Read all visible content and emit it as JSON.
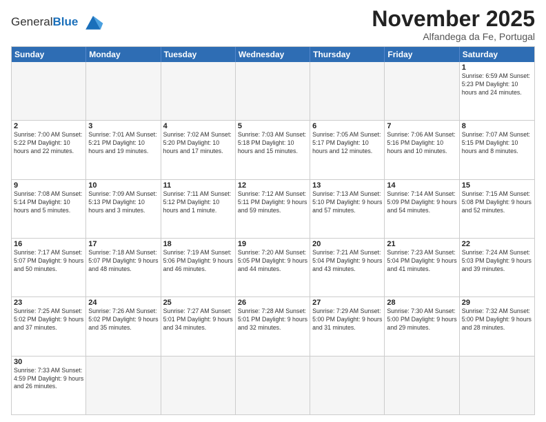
{
  "header": {
    "logo_general": "General",
    "logo_blue": "Blue",
    "month_title": "November 2025",
    "location": "Alfandega da Fe, Portugal"
  },
  "days_of_week": [
    "Sunday",
    "Monday",
    "Tuesday",
    "Wednesday",
    "Thursday",
    "Friday",
    "Saturday"
  ],
  "weeks": [
    [
      {
        "day": "",
        "empty": true
      },
      {
        "day": "",
        "empty": true
      },
      {
        "day": "",
        "empty": true
      },
      {
        "day": "",
        "empty": true
      },
      {
        "day": "",
        "empty": true
      },
      {
        "day": "",
        "empty": true
      },
      {
        "day": "1",
        "info": "Sunrise: 6:59 AM\nSunset: 5:23 PM\nDaylight: 10 hours\nand 24 minutes."
      }
    ],
    [
      {
        "day": "2",
        "info": "Sunrise: 7:00 AM\nSunset: 5:22 PM\nDaylight: 10 hours\nand 22 minutes."
      },
      {
        "day": "3",
        "info": "Sunrise: 7:01 AM\nSunset: 5:21 PM\nDaylight: 10 hours\nand 19 minutes."
      },
      {
        "day": "4",
        "info": "Sunrise: 7:02 AM\nSunset: 5:20 PM\nDaylight: 10 hours\nand 17 minutes."
      },
      {
        "day": "5",
        "info": "Sunrise: 7:03 AM\nSunset: 5:18 PM\nDaylight: 10 hours\nand 15 minutes."
      },
      {
        "day": "6",
        "info": "Sunrise: 7:05 AM\nSunset: 5:17 PM\nDaylight: 10 hours\nand 12 minutes."
      },
      {
        "day": "7",
        "info": "Sunrise: 7:06 AM\nSunset: 5:16 PM\nDaylight: 10 hours\nand 10 minutes."
      },
      {
        "day": "8",
        "info": "Sunrise: 7:07 AM\nSunset: 5:15 PM\nDaylight: 10 hours\nand 8 minutes."
      }
    ],
    [
      {
        "day": "9",
        "info": "Sunrise: 7:08 AM\nSunset: 5:14 PM\nDaylight: 10 hours\nand 5 minutes."
      },
      {
        "day": "10",
        "info": "Sunrise: 7:09 AM\nSunset: 5:13 PM\nDaylight: 10 hours\nand 3 minutes."
      },
      {
        "day": "11",
        "info": "Sunrise: 7:11 AM\nSunset: 5:12 PM\nDaylight: 10 hours\nand 1 minute."
      },
      {
        "day": "12",
        "info": "Sunrise: 7:12 AM\nSunset: 5:11 PM\nDaylight: 9 hours\nand 59 minutes."
      },
      {
        "day": "13",
        "info": "Sunrise: 7:13 AM\nSunset: 5:10 PM\nDaylight: 9 hours\nand 57 minutes."
      },
      {
        "day": "14",
        "info": "Sunrise: 7:14 AM\nSunset: 5:09 PM\nDaylight: 9 hours\nand 54 minutes."
      },
      {
        "day": "15",
        "info": "Sunrise: 7:15 AM\nSunset: 5:08 PM\nDaylight: 9 hours\nand 52 minutes."
      }
    ],
    [
      {
        "day": "16",
        "info": "Sunrise: 7:17 AM\nSunset: 5:07 PM\nDaylight: 9 hours\nand 50 minutes."
      },
      {
        "day": "17",
        "info": "Sunrise: 7:18 AM\nSunset: 5:07 PM\nDaylight: 9 hours\nand 48 minutes."
      },
      {
        "day": "18",
        "info": "Sunrise: 7:19 AM\nSunset: 5:06 PM\nDaylight: 9 hours\nand 46 minutes."
      },
      {
        "day": "19",
        "info": "Sunrise: 7:20 AM\nSunset: 5:05 PM\nDaylight: 9 hours\nand 44 minutes."
      },
      {
        "day": "20",
        "info": "Sunrise: 7:21 AM\nSunset: 5:04 PM\nDaylight: 9 hours\nand 43 minutes."
      },
      {
        "day": "21",
        "info": "Sunrise: 7:23 AM\nSunset: 5:04 PM\nDaylight: 9 hours\nand 41 minutes."
      },
      {
        "day": "22",
        "info": "Sunrise: 7:24 AM\nSunset: 5:03 PM\nDaylight: 9 hours\nand 39 minutes."
      }
    ],
    [
      {
        "day": "23",
        "info": "Sunrise: 7:25 AM\nSunset: 5:02 PM\nDaylight: 9 hours\nand 37 minutes."
      },
      {
        "day": "24",
        "info": "Sunrise: 7:26 AM\nSunset: 5:02 PM\nDaylight: 9 hours\nand 35 minutes."
      },
      {
        "day": "25",
        "info": "Sunrise: 7:27 AM\nSunset: 5:01 PM\nDaylight: 9 hours\nand 34 minutes."
      },
      {
        "day": "26",
        "info": "Sunrise: 7:28 AM\nSunset: 5:01 PM\nDaylight: 9 hours\nand 32 minutes."
      },
      {
        "day": "27",
        "info": "Sunrise: 7:29 AM\nSunset: 5:00 PM\nDaylight: 9 hours\nand 31 minutes."
      },
      {
        "day": "28",
        "info": "Sunrise: 7:30 AM\nSunset: 5:00 PM\nDaylight: 9 hours\nand 29 minutes."
      },
      {
        "day": "29",
        "info": "Sunrise: 7:32 AM\nSunset: 5:00 PM\nDaylight: 9 hours\nand 28 minutes."
      }
    ],
    [
      {
        "day": "30",
        "info": "Sunrise: 7:33 AM\nSunset: 4:59 PM\nDaylight: 9 hours\nand 26 minutes."
      },
      {
        "day": "",
        "empty": true
      },
      {
        "day": "",
        "empty": true
      },
      {
        "day": "",
        "empty": true
      },
      {
        "day": "",
        "empty": true
      },
      {
        "day": "",
        "empty": true
      },
      {
        "day": "",
        "empty": true
      }
    ]
  ]
}
